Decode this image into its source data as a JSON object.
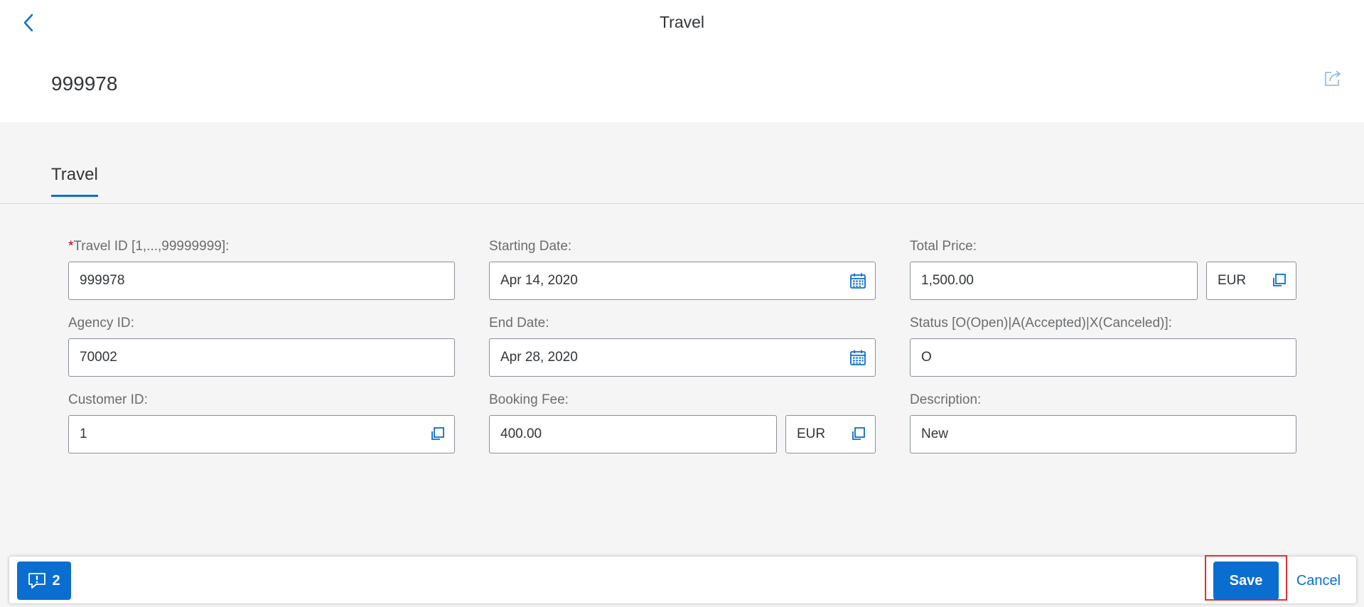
{
  "shell": {
    "title": "Travel"
  },
  "header": {
    "object_title": "999978"
  },
  "section": {
    "tab_label": "Travel"
  },
  "form": {
    "travel_id": {
      "required_mark": "*",
      "label": "Travel ID [1,...,99999999]:",
      "value": "999978"
    },
    "agency_id": {
      "label": "Agency ID:",
      "value": "70002"
    },
    "customer_id": {
      "label": "Customer ID:",
      "value": "1"
    },
    "starting_date": {
      "label": "Starting Date:",
      "value": "Apr 14, 2020"
    },
    "end_date": {
      "label": "End Date:",
      "value": "Apr 28, 2020"
    },
    "booking_fee": {
      "label": "Booking Fee:",
      "value": "400.00",
      "currency": "EUR"
    },
    "total_price": {
      "label": "Total Price:",
      "value": "1,500.00",
      "currency": "EUR"
    },
    "status": {
      "label": "Status [O(Open)|A(Accepted)|X(Canceled)]:",
      "value": "O"
    },
    "description": {
      "label": "Description:",
      "value": "New"
    }
  },
  "footer": {
    "message_count": "2",
    "save_label": "Save",
    "cancel_label": "Cancel"
  },
  "colors": {
    "accent": "#0a6ed1",
    "highlight_frame": "#e03030",
    "required": "#bb0000"
  }
}
